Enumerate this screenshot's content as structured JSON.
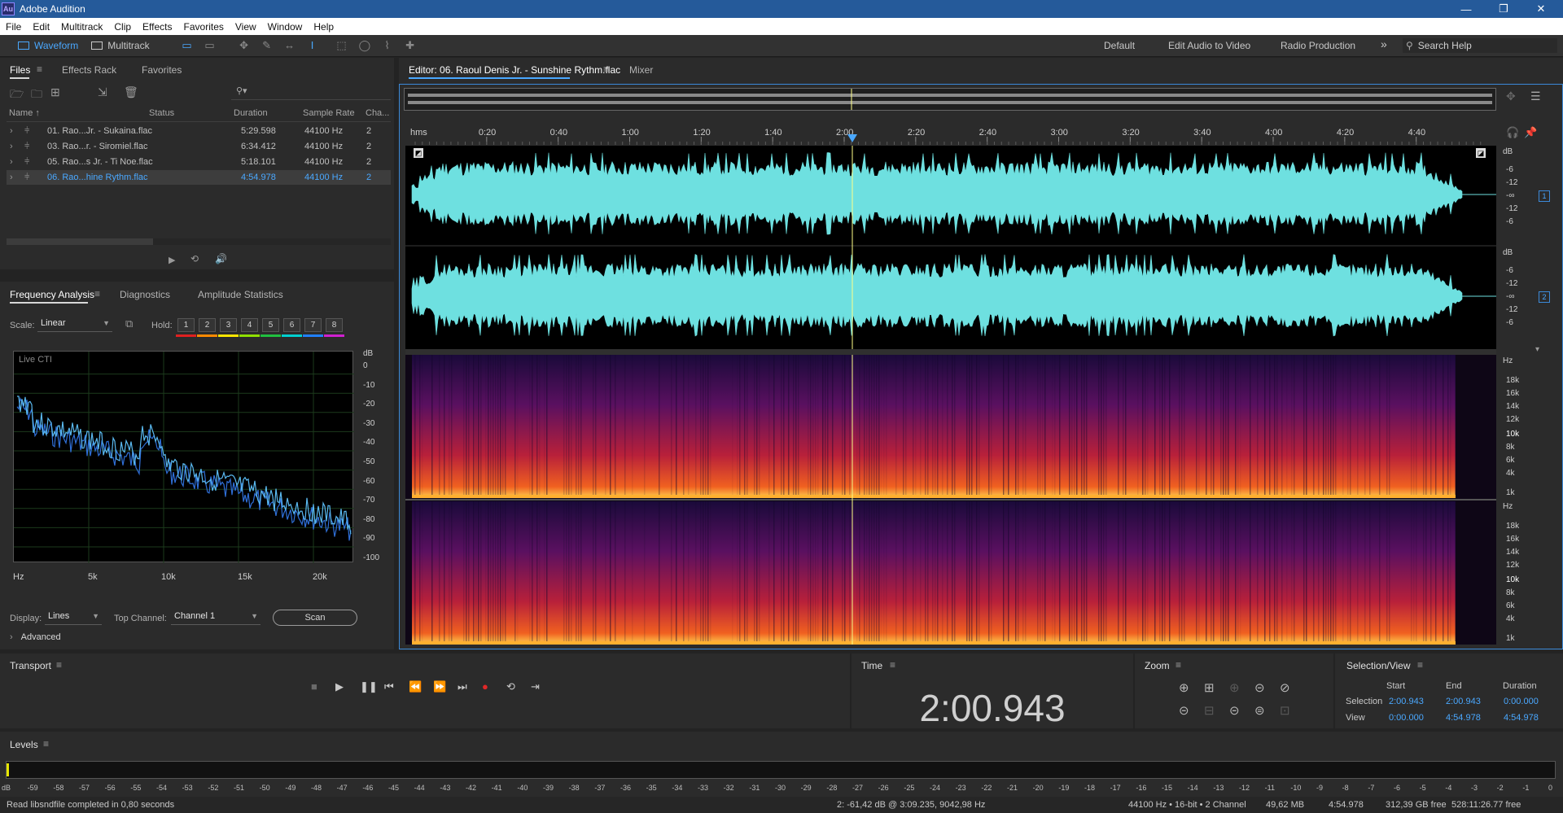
{
  "app": {
    "title": "Adobe Audition",
    "icon_text": "Au",
    "window_controls": [
      "—",
      "❐",
      "✕"
    ]
  },
  "menu": [
    "File",
    "Edit",
    "Multitrack",
    "Clip",
    "Effects",
    "Favorites",
    "View",
    "Window",
    "Help"
  ],
  "toolbar": {
    "waveform_label": "Waveform",
    "multitrack_label": "Multitrack",
    "workspaces": [
      "Default",
      "Edit Audio to Video",
      "Radio Production"
    ],
    "more": "»",
    "search_placeholder": "Search Help"
  },
  "files_panel": {
    "tabs": [
      "Files",
      "Effects Rack",
      "Favorites"
    ],
    "search_icon": "⚲▾",
    "columns": [
      "Name ↑",
      "Status",
      "Duration",
      "Sample Rate",
      "Cha..."
    ],
    "rows": [
      {
        "name": "01. Rao...Jr. - Sukaina.flac",
        "duration": "5:29.598",
        "rate": "44100 Hz",
        "ch": "2",
        "selected": false
      },
      {
        "name": "03. Rao...r. - Siromiel.flac",
        "duration": "6:34.412",
        "rate": "44100 Hz",
        "ch": "2",
        "selected": false
      },
      {
        "name": "05. Rao...s Jr. - Ti Noe.flac",
        "duration": "5:18.101",
        "rate": "44100 Hz",
        "ch": "2",
        "selected": false
      },
      {
        "name": "06. Rao...hine Rythm.flac",
        "duration": "4:54.978",
        "rate": "44100 Hz",
        "ch": "2",
        "selected": true
      }
    ]
  },
  "freq_panel": {
    "tabs": [
      "Frequency Analysis",
      "Diagnostics",
      "Amplitude Statistics"
    ],
    "scale_label": "Scale:",
    "scale_value": "Linear",
    "hold_label": "Hold:",
    "hold": [
      "1",
      "2",
      "3",
      "4",
      "5",
      "6",
      "7",
      "8"
    ],
    "hold_colors": [
      "#e02020",
      "#ff8a00",
      "#ffe600",
      "#8fe000",
      "#20c040",
      "#00d0d0",
      "#2080ff",
      "#d020d0"
    ],
    "live_label": "Live CTI",
    "db_unit": "dB",
    "db_ticks": [
      "0",
      "-10",
      "-20",
      "-30",
      "-40",
      "-50",
      "-60",
      "-70",
      "-80",
      "-90",
      "-100"
    ],
    "hz_ticks": [
      "Hz",
      "5k",
      "10k",
      "15k",
      "20k"
    ],
    "display_label": "Display:",
    "display_value": "Lines",
    "channel_label": "Top Channel:",
    "channel_value": "Channel 1",
    "scan_label": "Scan",
    "advanced_label": "Advanced",
    "curve_color": "#5ab9f0",
    "curve2_color": "#2f6fd8"
  },
  "editor": {
    "tab_label": "Editor: 06. Raoul Denis Jr. - Sunshine Rythm.flac",
    "mixer_label": "Mixer",
    "ruler": [
      "hms",
      "0:20",
      "0:40",
      "1:00",
      "1:20",
      "1:40",
      "2:00",
      "2:20",
      "2:40",
      "3:00",
      "3:20",
      "3:40",
      "4:00",
      "4:20",
      "4:40"
    ],
    "db_labels": [
      "dB",
      "-6",
      "-12",
      "-∞",
      "-12",
      "-6"
    ],
    "hz_labels": [
      "Hz",
      "18k",
      "16k",
      "14k",
      "12k",
      "10k",
      "8k",
      "6k",
      "4k",
      "1k"
    ],
    "channels": [
      "1",
      "2"
    ],
    "wave_color": "#6ee0e0",
    "playhead_color": "#ffff88"
  },
  "transport": {
    "title": "Transport",
    "buttons": [
      "■",
      "▶",
      "❚❚",
      "⏮",
      "⏪",
      "⏩",
      "⏭",
      "●",
      "⟲",
      "⇥"
    ]
  },
  "time": {
    "title": "Time",
    "value": "2:00.943"
  },
  "zoom": {
    "title": "Zoom",
    "icons": [
      "⊕",
      "⊞",
      "⊕",
      "⊝",
      "⊘",
      "⊝",
      "⊟",
      "⊝",
      "⊜",
      "⊡"
    ]
  },
  "selview": {
    "title": "Selection/View",
    "headers": [
      "Start",
      "End",
      "Duration"
    ],
    "selection_label": "Selection",
    "view_label": "View",
    "selection": [
      "2:00.943",
      "2:00.943",
      "0:00.000"
    ],
    "view": [
      "0:00.000",
      "4:54.978",
      "4:54.978"
    ]
  },
  "levels": {
    "title": "Levels",
    "ticks": [
      "dB",
      "-59",
      "-58",
      "-57",
      "-56",
      "-55",
      "-54",
      "-53",
      "-52",
      "-51",
      "-50",
      "-49",
      "-48",
      "-47",
      "-46",
      "-45",
      "-44",
      "-43",
      "-42",
      "-41",
      "-40",
      "-39",
      "-38",
      "-37",
      "-36",
      "-35",
      "-34",
      "-33",
      "-32",
      "-31",
      "-30",
      "-29",
      "-28",
      "-27",
      "-26",
      "-25",
      "-24",
      "-23",
      "-22",
      "-21",
      "-20",
      "-19",
      "-18",
      "-17",
      "-16",
      "-15",
      "-14",
      "-13",
      "-12",
      "-11",
      "-10",
      "-9",
      "-8",
      "-7",
      "-6",
      "-5",
      "-4",
      "-3",
      "-2",
      "-1",
      "0"
    ]
  },
  "status": {
    "message": "Read libsndfile completed in 0,80 seconds",
    "cursor": "2: -61,42 dB @ 3:09.235, 9042,98 Hz",
    "format": "44100 Hz • 16-bit • 2 Channel",
    "size": "49,62 MB",
    "duration": "4:54.978",
    "free": "312,39 GB free",
    "free_time": "528:11:26.77 free"
  }
}
